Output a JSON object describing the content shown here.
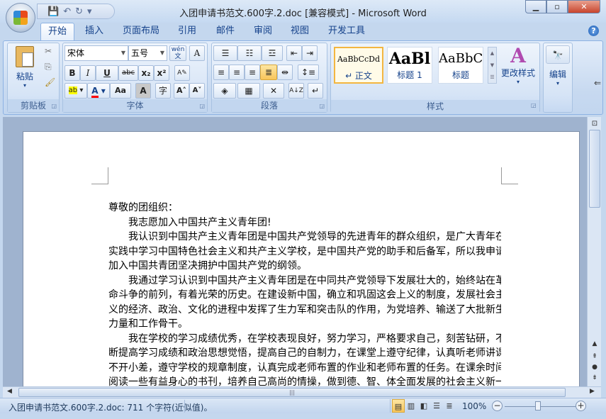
{
  "window": {
    "title": "入团申请书范文.600字.2.doc [兼容模式] - Microsoft Word",
    "minimize": "▁",
    "restore": "▫",
    "close": "✕"
  },
  "qat": {
    "save": "💾",
    "undo": "↶",
    "redo": "↻",
    "customize": "▾"
  },
  "tabs": [
    "开始",
    "插入",
    "页面布局",
    "引用",
    "邮件",
    "审阅",
    "视图",
    "开发工具"
  ],
  "help": "?",
  "clipboard": {
    "label": "剪贴板",
    "paste": "粘贴",
    "cut": "✂",
    "copy": "⎘",
    "format_painter": "🖌"
  },
  "font": {
    "label": "字体",
    "font_name": "宋体",
    "font_size": "五号",
    "phonetic": "wén文",
    "border": "A",
    "bold": "B",
    "italic": "I",
    "underline": "U",
    "strike": "abc",
    "subscript": "x₂",
    "superscript": "x²",
    "clear": "A✎",
    "highlight": "ab",
    "font_color": "A",
    "case": "Aa",
    "shading": "A",
    "enclose": "字",
    "grow": "A˄",
    "shrink": "A˅",
    "highlight_color": "#ffff00",
    "font_color_value": "#ff0000"
  },
  "paragraph": {
    "label": "段落",
    "bullets": "☰",
    "numbering": "☷",
    "multilevel": "☲",
    "decrease_indent": "⇤",
    "increase_indent": "⇥",
    "align_left": "≡",
    "center": "≡",
    "align_right": "≡",
    "justify": "≣",
    "distributed": "⇹",
    "line_spacing": "↕≡",
    "shading": "◈",
    "borders": "▦",
    "asian_layout": "✕",
    "sort": "A↓Z",
    "show_marks": "↵"
  },
  "styles": {
    "label": "样式",
    "items": [
      {
        "preview": "AaBbCcDd",
        "name": "↵ 正文"
      },
      {
        "preview": "AaBl",
        "name": "标题 1"
      },
      {
        "preview": "AaBbC",
        "name": "标题"
      }
    ],
    "change_styles": "更改样式"
  },
  "editing": {
    "label": "编辑",
    "icon": "🔭"
  },
  "document": {
    "lines": [
      {
        "t": "尊敬的团组织：",
        "c": "end"
      },
      {
        "t": "我志愿加入中国共产主义青年团!",
        "c": "ind end"
      },
      {
        "t": "我认识到中国共产主义青年团是中国共产党领导的先进青年的群众组织，是广大青年在",
        "c": "ind"
      },
      {
        "t": "实践中学习中国特色社会主义和共产主义学校，是中国共产党的助手和后备军，所以我申请",
        "c": ""
      },
      {
        "t": "加入中国共青团坚决拥护中国共产党的纲领。",
        "c": "end"
      },
      {
        "t": "我通过学习认识到中国共产主义青年团是在中同共产党领导下发展壮大的，始终站在革",
        "c": "ind"
      },
      {
        "t": "命斗争的前列，有着光荣的历史。在建设新中国，确立和巩固这会上义的制度，发展社会主",
        "c": ""
      },
      {
        "t": "义的经济、政治、文化的进程中发挥了生力军和突击队的作用，为党培养、输送了大批新生",
        "c": ""
      },
      {
        "t": "力量和工作骨干。",
        "c": "end"
      },
      {
        "t": "我在学校的学习成绩优秀，在学校表现良好，努力学习，严格要求自己，刻苦钻研，不",
        "c": "ind"
      },
      {
        "t": "断提高学习成绩和政治思想觉悟，提高自己的自制力，在课堂上遵守纪律，认真听老师讲课，",
        "c": ""
      },
      {
        "t": "不开小差，遵守学校的规章制度，认真完成老师布置的作业和老师布置的任务。在课余时间",
        "c": ""
      },
      {
        "t": "阅读一些有益身心的书刊，培养自己高尚的情操，做到德、智、体全面发展的社会主义新一",
        "c": ""
      }
    ]
  },
  "status": {
    "text": "入团申请书范文.600字.2.doc: 711 个字符(近似值)。",
    "zoom": "100%",
    "zoom_out": "−",
    "zoom_in": "+",
    "zoom_level_percent": 100
  },
  "views": [
    "▤",
    "▥",
    "◧",
    "☰",
    "≣"
  ]
}
